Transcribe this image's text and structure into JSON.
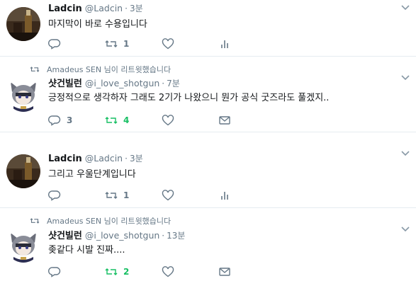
{
  "colors": {
    "accent": "#17bf63",
    "muted": "#657786",
    "text": "#14171a",
    "divider": "#e6ecf0"
  },
  "tweets": [
    {
      "retweet_context": null,
      "fullname": "Ladcin",
      "username": "@Ladcin",
      "dot": "·",
      "time": "3분",
      "text": "마지막이 바로 수용입니다",
      "reply_count": "",
      "retweet_count": "1",
      "like_count": ""
    },
    {
      "retweet_context": "Amadeus SEN 님이 리트윗했습니다",
      "fullname": "샷건빌런",
      "username": "@i_love_shotgun",
      "dot": "·",
      "time": "7분",
      "text": "긍정적으로 생각하자 그래도 2기가 나왔으니 뭔가 공식 굿즈라도 풀겠지..",
      "reply_count": "3",
      "retweet_count": "4",
      "like_count": ""
    },
    {
      "retweet_context": null,
      "fullname": "Ladcin",
      "username": "@Ladcin",
      "dot": "·",
      "time": "3분",
      "text": "그리고 우울단계입니다",
      "reply_count": "",
      "retweet_count": "1",
      "like_count": ""
    },
    {
      "retweet_context": "Amadeus SEN 님이 리트윗했습니다",
      "fullname": "샷건빌런",
      "username": "@i_love_shotgun",
      "dot": "·",
      "time": "13분",
      "text": "좆같다 시발 진짜....",
      "reply_count": "",
      "retweet_count": "2",
      "like_count": ""
    }
  ]
}
